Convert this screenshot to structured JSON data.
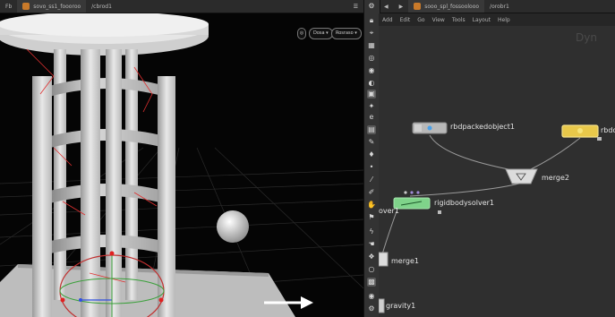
{
  "viewport_tabs": [
    {
      "label": "Fb"
    },
    {
      "label": "sovo_ss1_foooroo"
    },
    {
      "label": "/cbrod1"
    }
  ],
  "network_tabs": [
    {
      "label": "sooo_spl_fossoolooo"
    },
    {
      "label": "/orobr1"
    }
  ],
  "viewport": {
    "display_btn": "Dosa",
    "shading_btn": "Rosraso"
  },
  "network": {
    "menu": [
      "Add",
      "Edit",
      "Go",
      "View",
      "Tools",
      "Layout",
      "Help"
    ],
    "watermark": "Dyn",
    "nodes": {
      "rbdpacked": "rbdpackedobject1",
      "rbdo": "rbdo",
      "merge2": "merge2",
      "rigidbodysolver": "rigidbodysolver1",
      "solver_left": "over1",
      "merge1": "merge1",
      "gravity1": "gravity1"
    }
  },
  "colors": {
    "viewport_bg": "#050505",
    "network_bg": "#2f2f2f",
    "solver_node": "#7fd38a",
    "object_node_selected": "#e8c84a"
  }
}
